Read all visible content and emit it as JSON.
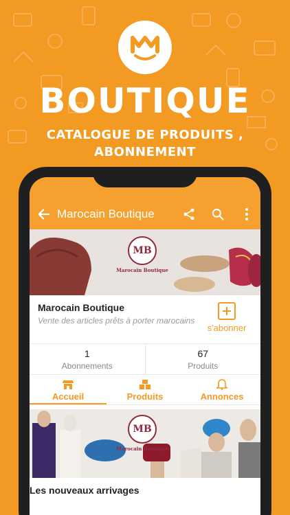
{
  "promo": {
    "headline": "BOUTIQUE",
    "subtitle_line1": "CATALOGUE DE PRODUITS ,",
    "subtitle_line2": "ABONNEMENT",
    "logo_icon": "smiling-m-logo-icon"
  },
  "colors": {
    "brand_orange": "#F39A22",
    "appbar_orange": "#F6A030",
    "brand_burgundy": "#8F2A3F"
  },
  "appbar": {
    "title": "Marocain Boutique",
    "icons": [
      "back-arrow-icon",
      "share-icon",
      "search-icon",
      "more-vert-icon"
    ]
  },
  "banner": {
    "brand_monogram": "MB",
    "brand_caption": "Marocain Boutique"
  },
  "profile": {
    "name": "Marocain Boutique",
    "description": "Vente des articles prêts à porter marocains",
    "subscribe_label": "s'abonner"
  },
  "stats": [
    {
      "value": "1",
      "label": "Abonnements"
    },
    {
      "value": "67",
      "label": "Produits"
    }
  ],
  "tabs": [
    {
      "label": "Accueil",
      "icon": "store-icon",
      "active": true
    },
    {
      "label": "Produits",
      "icon": "boxes-icon",
      "active": false
    },
    {
      "label": "Annonces",
      "icon": "bell-icon",
      "active": false
    }
  ],
  "banner2": {
    "brand_monogram": "MB",
    "brand_caption": "Marocain Boutique"
  },
  "sections": {
    "new_arrivals_title": "Les nouveaux arrivages"
  }
}
